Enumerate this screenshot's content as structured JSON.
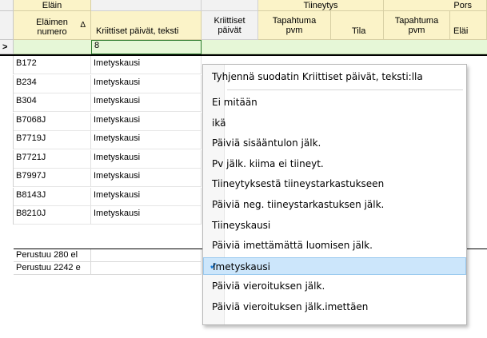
{
  "grid": {
    "group_headers": [
      "Eläin",
      "Tiineytys",
      "Pors"
    ],
    "col_headers": {
      "elaimen_numero": "Eläimen numero",
      "sort_indicator": "Δ",
      "kriittiset_teksti": "Kriittiset päivät, teksti",
      "kriittiset_paivat": "Kriittiset päivät",
      "tiineytys_tapahtuma": "Tapahtuma pvm",
      "tiineytys_tila": "Tila",
      "pors_tapahtuma": "Tapahtuma pvm",
      "pors_elaimen": "Eläi"
    },
    "row_indicator": ">",
    "filter_value": "8",
    "rows": [
      {
        "id": "B172",
        "text": "Imetyskausi"
      },
      {
        "id": "B234",
        "text": "Imetyskausi"
      },
      {
        "id": "B304",
        "text": "Imetyskausi"
      },
      {
        "id": "B7068J",
        "text": "Imetyskausi"
      },
      {
        "id": "B7719J",
        "text": "Imetyskausi"
      },
      {
        "id": "B7721J",
        "text": "Imetyskausi"
      },
      {
        "id": "B7997J",
        "text": "Imetyskausi"
      },
      {
        "id": "B8143J",
        "text": "Imetyskausi"
      },
      {
        "id": "B8210J",
        "text": "Imetyskausi"
      }
    ],
    "footer": [
      "Perustuu 280 el",
      "Perustuu 2242 e"
    ]
  },
  "menu": {
    "clear_label": "Tyhjennä suodatin Kriittiset päivät, teksti:lla",
    "items": [
      {
        "label": "Ei mitään",
        "checked": false
      },
      {
        "label": "ikä",
        "checked": false
      },
      {
        "label": "Päiviä sisääntulon jälk.",
        "checked": false
      },
      {
        "label": "Pv jälk. kiima ei tiineyt.",
        "checked": false
      },
      {
        "label": "Tiineytyksestä tiineystarkastukseen",
        "checked": false
      },
      {
        "label": "Päiviä neg. tiineystarkastuksen jälk.",
        "checked": false
      },
      {
        "label": "Tiineyskausi",
        "checked": false
      },
      {
        "label": "Päiviä imettämättä luomisen jälk.",
        "checked": false
      },
      {
        "label": "Imetyskausi",
        "checked": true
      },
      {
        "label": "Päiviä vieroituksen jälk.",
        "checked": false
      },
      {
        "label": "Päiviä vieroituksen jälk.imettäen",
        "checked": false
      }
    ],
    "check_icon": "checkmark-icon",
    "accent": "#1f7ed6"
  }
}
